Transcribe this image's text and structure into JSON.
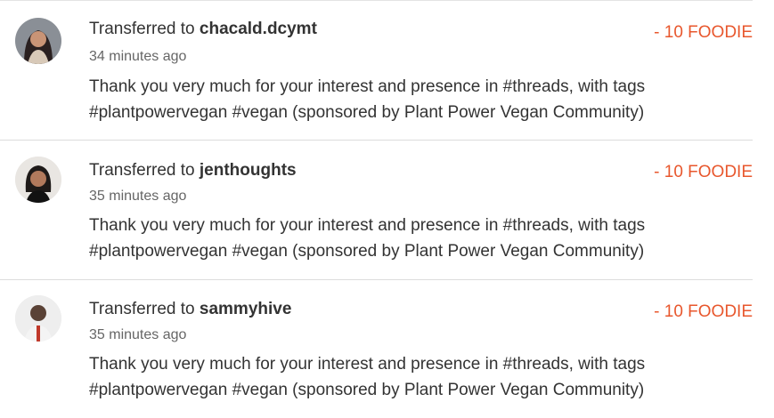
{
  "transactions": [
    {
      "prefix": "Transferred to ",
      "user": "chacald.dcymt",
      "time": "34 minutes ago",
      "amount": "- 10 FOODIE",
      "message_line1": "Thank you very much for your interest and presence in #threads, with tags",
      "message_line2": "#plantpowervegan #vegan (sponsored by Plant Power Vegan Community)"
    },
    {
      "prefix": "Transferred to ",
      "user": "jenthoughts",
      "time": "35 minutes ago",
      "amount": "- 10 FOODIE",
      "message_line1": "Thank you very much for your interest and presence in #threads, with tags",
      "message_line2": "#plantpowervegan #vegan (sponsored by Plant Power Vegan Community)"
    },
    {
      "prefix": "Transferred to ",
      "user": "sammyhive",
      "time": "35 minutes ago",
      "amount": "- 10 FOODIE",
      "message_line1": "Thank you very much for your interest and presence in #threads, with tags",
      "message_line2": "#plantpowervegan #vegan (sponsored by Plant Power Vegan Community)"
    }
  ],
  "colors": {
    "amount": "#e8572d",
    "divider": "#dcdcdc"
  }
}
